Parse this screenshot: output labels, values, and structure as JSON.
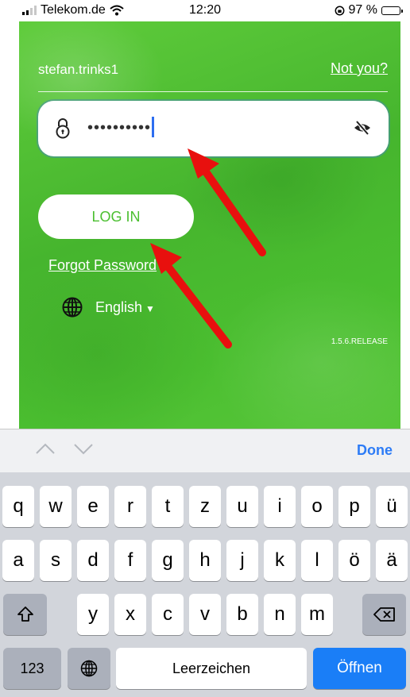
{
  "status_bar": {
    "carrier": "Telekom.de",
    "time": "12:20",
    "battery": "97 %",
    "battery_level": 0.97
  },
  "login": {
    "username": "stefan.trinks1",
    "not_you": "Not you?",
    "password_masked": "••••••••••",
    "login_button": "LOG IN",
    "forgot_password": "Forgot Password",
    "language": "English",
    "version": "1.5.6.RELEASE"
  },
  "keyboard": {
    "done": "Done",
    "row1": [
      "q",
      "w",
      "e",
      "r",
      "t",
      "z",
      "u",
      "i",
      "o",
      "p",
      "ü"
    ],
    "row2": [
      "a",
      "s",
      "d",
      "f",
      "g",
      "h",
      "j",
      "k",
      "l",
      "ö",
      "ä"
    ],
    "row3": [
      "y",
      "x",
      "c",
      "v",
      "b",
      "n",
      "m"
    ],
    "numbers": "123",
    "space": "Leerzeichen",
    "go": "Öffnen"
  },
  "icons": [
    "wifi-icon",
    "lock-icon",
    "eye-off-icon",
    "globe-icon",
    "shift-icon",
    "backspace-icon",
    "chevron-up-icon",
    "chevron-down-icon"
  ],
  "colors": {
    "brand_green": "#4bbf30",
    "accent_blue": "#1a7ef7",
    "annotation_red": "#e8100e"
  }
}
